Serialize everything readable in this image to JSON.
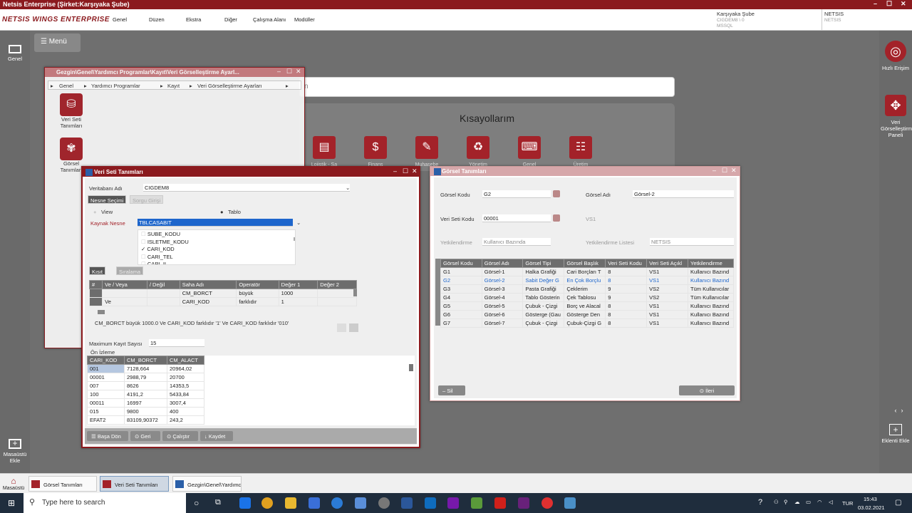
{
  "app": {
    "title": "Netsis Enterprise (Şirket:Karşıyaka Şube)",
    "logo": "NETSIS WINGS ENTERPRISE"
  },
  "menu": [
    "Genel",
    "Düzen",
    "Ekstra",
    "Diğer",
    "Çalışma Alanı",
    "Modüller"
  ],
  "company": {
    "branch": "Karşıyaka Şube",
    "db": "CIGDEM8 \\ 0",
    "server": "MSSQL",
    "user": "NETSIS",
    "user2": "NETSIS"
  },
  "left_sidebar": {
    "genel": "Genel",
    "add_desktop": "Masaüstü Ekle",
    "menu": "Menü"
  },
  "right_sidebar": {
    "quick": "Hızlı Erişim",
    "panel": "Veri Görselleştirme Paneli",
    "widget": "Eklenti Ekle"
  },
  "search": {
    "placeholder": "n"
  },
  "shortcuts": {
    "title": "Kısayollarım",
    "items": [
      "Lojistik - Sa",
      "Finans",
      "Muhasebe",
      "Yönetim",
      "Genel",
      "Üretim"
    ]
  },
  "gezgin": {
    "title": "Gezgin\\Genel\\Yardımcı Programlar\\Kayıt\\Veri Görselleştirme Ayarl...",
    "crumbs": [
      "Genel",
      "Yardımcı Programlar",
      "Kayıt",
      "Veri Görselleştirme Ayarları"
    ],
    "items": [
      "Veri Seti Tanımları",
      "Görsel Tanımları"
    ]
  },
  "veriseti": {
    "title": "Veri Seti Tanımları",
    "db_label": "Veritabanı Adı",
    "db_value": "CIGDEM8",
    "tab1": "Nesne Seçimi",
    "tab2": "Sorgu Girişi",
    "view": "View",
    "table": "Tablo",
    "src_label": "Kaynak Nesne",
    "src_value": "TBLCASABIT",
    "fields": [
      {
        "name": "SUBE_KODU",
        "checked": false
      },
      {
        "name": "ISLETME_KODU",
        "checked": false
      },
      {
        "name": "CARI_KOD",
        "checked": true
      },
      {
        "name": "CARI_TEL",
        "checked": false
      },
      {
        "name": "CARI_IL",
        "checked": false
      }
    ],
    "tab3": "Kısıt",
    "tab4": "Sıralama",
    "filter_cols": [
      "#",
      "Ve / Veya",
      "/ Değil",
      "Saha Adı",
      "Operatör",
      "Değer 1",
      "Değer 2"
    ],
    "filter_rows": [
      [
        "",
        "",
        "",
        "CM_BORCT",
        "büyük",
        "1000",
        ""
      ],
      [
        "",
        "Ve",
        "",
        "CARI_KOD",
        "farklıdır",
        "1",
        ""
      ]
    ],
    "expr": "CM_BORCT büyük 1000.0 Ve CARI_KOD farklıdır '1' Ve CARI_KOD farklıdır '010'",
    "max_label": "Maximum Kayıt Sayısı",
    "max_value": "15",
    "preview_label": "Ön İzleme",
    "preview_cols": [
      "CARI_KOD",
      "CM_BORCT",
      "CM_ALACT"
    ],
    "preview_rows": [
      [
        "001",
        "7128,664",
        "20964,02"
      ],
      [
        "00001",
        "2988,79",
        "20700"
      ],
      [
        "007",
        "8626",
        "14353,5"
      ],
      [
        "100",
        "4191,2",
        "5433,84"
      ],
      [
        "00011",
        "16997",
        "3007,4"
      ],
      [
        "015",
        "9800",
        "400"
      ],
      [
        "EFAT2",
        "83109,90372",
        "243,2"
      ]
    ],
    "buttons": [
      "Başa Dön",
      "Geri",
      "Çalıştır",
      "Kaydet"
    ]
  },
  "gorsel": {
    "title": "Görsel Tanımları",
    "kod_label": "Görsel Kodu",
    "kod": "G2",
    "ad_label": "Görsel Adı",
    "ad": "Görsel-2",
    "vs_label": "Veri Seti Kodu",
    "vs": "00001",
    "vs_name": "VS1",
    "yetki_label": "Yetkilendirme",
    "yetki": "Kullanıcı Bazında",
    "yetki_list_label": "Yetkilendirme Listesi",
    "yetki_list": "NETSIS",
    "cols": [
      "Görsel Kodu",
      "Görsel Adı",
      "Görsel Tipi",
      "Görsel Başlık",
      "Veri Seti Kodu",
      "Veri Seti Açıkl",
      "Yetkilendirme"
    ],
    "rows": [
      [
        "G1",
        "Görsel-1",
        "Halka Grafiği",
        "Cari Borçları T",
        "8",
        "VS1",
        "Kullanıcı Bazınd"
      ],
      [
        "G2",
        "Görsel-2",
        "Sabit Değer G",
        "En Çok Borçlu",
        "8",
        "VS1",
        "Kullanıcı Bazınd"
      ],
      [
        "G3",
        "Görsel-3",
        "Pasta Grafiği",
        "Çeklerim",
        "9",
        "VS2",
        "Tüm Kullanıcılar"
      ],
      [
        "G4",
        "Görsel-4",
        "Tablo Gösterin",
        "Çek Tablosu",
        "9",
        "VS2",
        "Tüm Kullanıcılar"
      ],
      [
        "G5",
        "Görsel-5",
        "Çubuk - Çizgi",
        "Borç ve Alacal",
        "8",
        "VS1",
        "Kullanıcı Bazınd"
      ],
      [
        "G6",
        "Görsel-6",
        "Gösterge (Gau",
        "Gösterge Den",
        "8",
        "VS1",
        "Kullanıcı Bazınd"
      ],
      [
        "G7",
        "Görsel-7",
        "Çubuk - Çizgi",
        "Çubuk-Çizgi G",
        "8",
        "VS1",
        "Kullanıcı Bazınd"
      ]
    ],
    "sil": "Sil",
    "ileri": "İleri"
  },
  "taskbar": {
    "masaustu": "Masaüstü",
    "apps": [
      "Görsel Tanımları",
      "Veri Seti Tanımları",
      "Gezgin\\Genel\\Yardımc"
    ],
    "search": "Type here to search",
    "lang": "TUR",
    "time": "15:43",
    "date": "03.02.2021"
  },
  "colors": {
    "brand": "#8b1a1e",
    "accent": "#a32229"
  }
}
